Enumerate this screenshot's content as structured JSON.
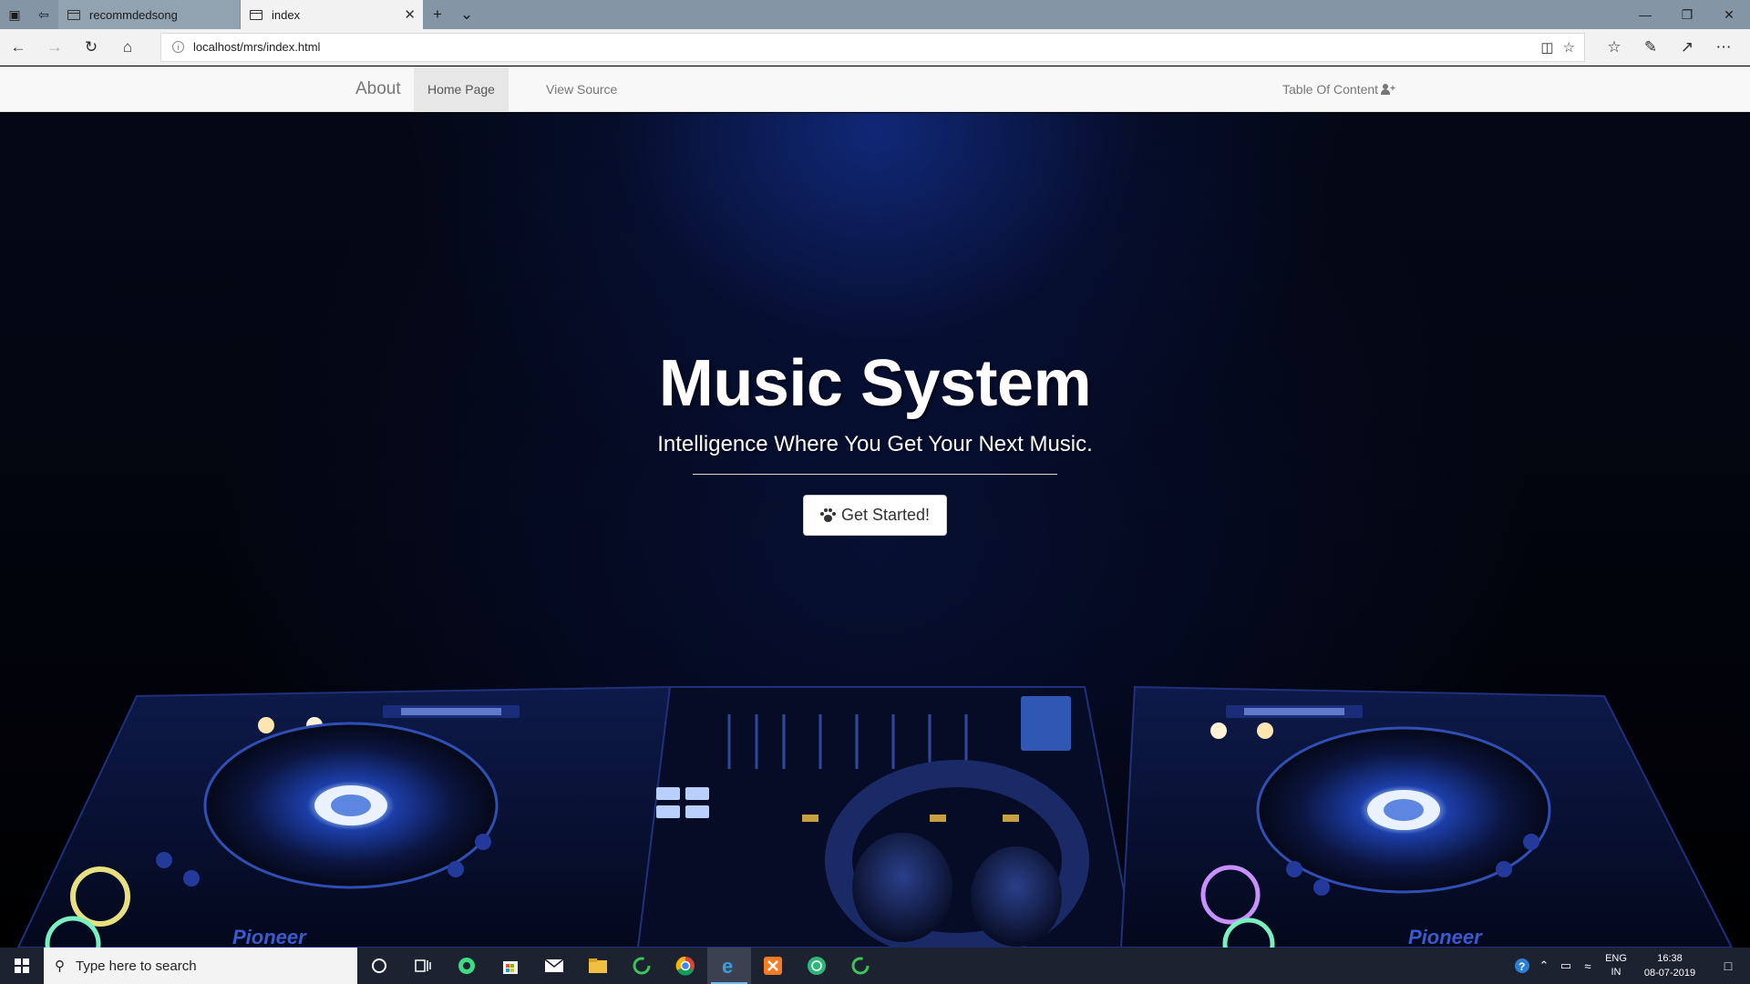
{
  "browser": {
    "tabs": [
      {
        "title": "recommdedsong",
        "active": false
      },
      {
        "title": "index",
        "active": true
      }
    ],
    "url": "localhost/mrs/index.html"
  },
  "site_nav": {
    "brand": "About",
    "links": [
      {
        "label": "Home Page",
        "active": true
      },
      {
        "label": "View Source",
        "active": false
      }
    ],
    "toc": "Table Of Content"
  },
  "hero": {
    "title": "Music System",
    "subtitle": "Intelligence Where You Get Your Next Music.",
    "cta_label": "Get Started!"
  },
  "deck_labels": {
    "brand": "Pioneer"
  },
  "taskbar": {
    "search_placeholder": "Type here to search",
    "lang_line1": "ENG",
    "lang_line2": "IN",
    "time": "16:38",
    "date": "08-07-2019"
  },
  "colors": {
    "accent": "#0063b1",
    "hero_glow": "#1a3a9a"
  }
}
